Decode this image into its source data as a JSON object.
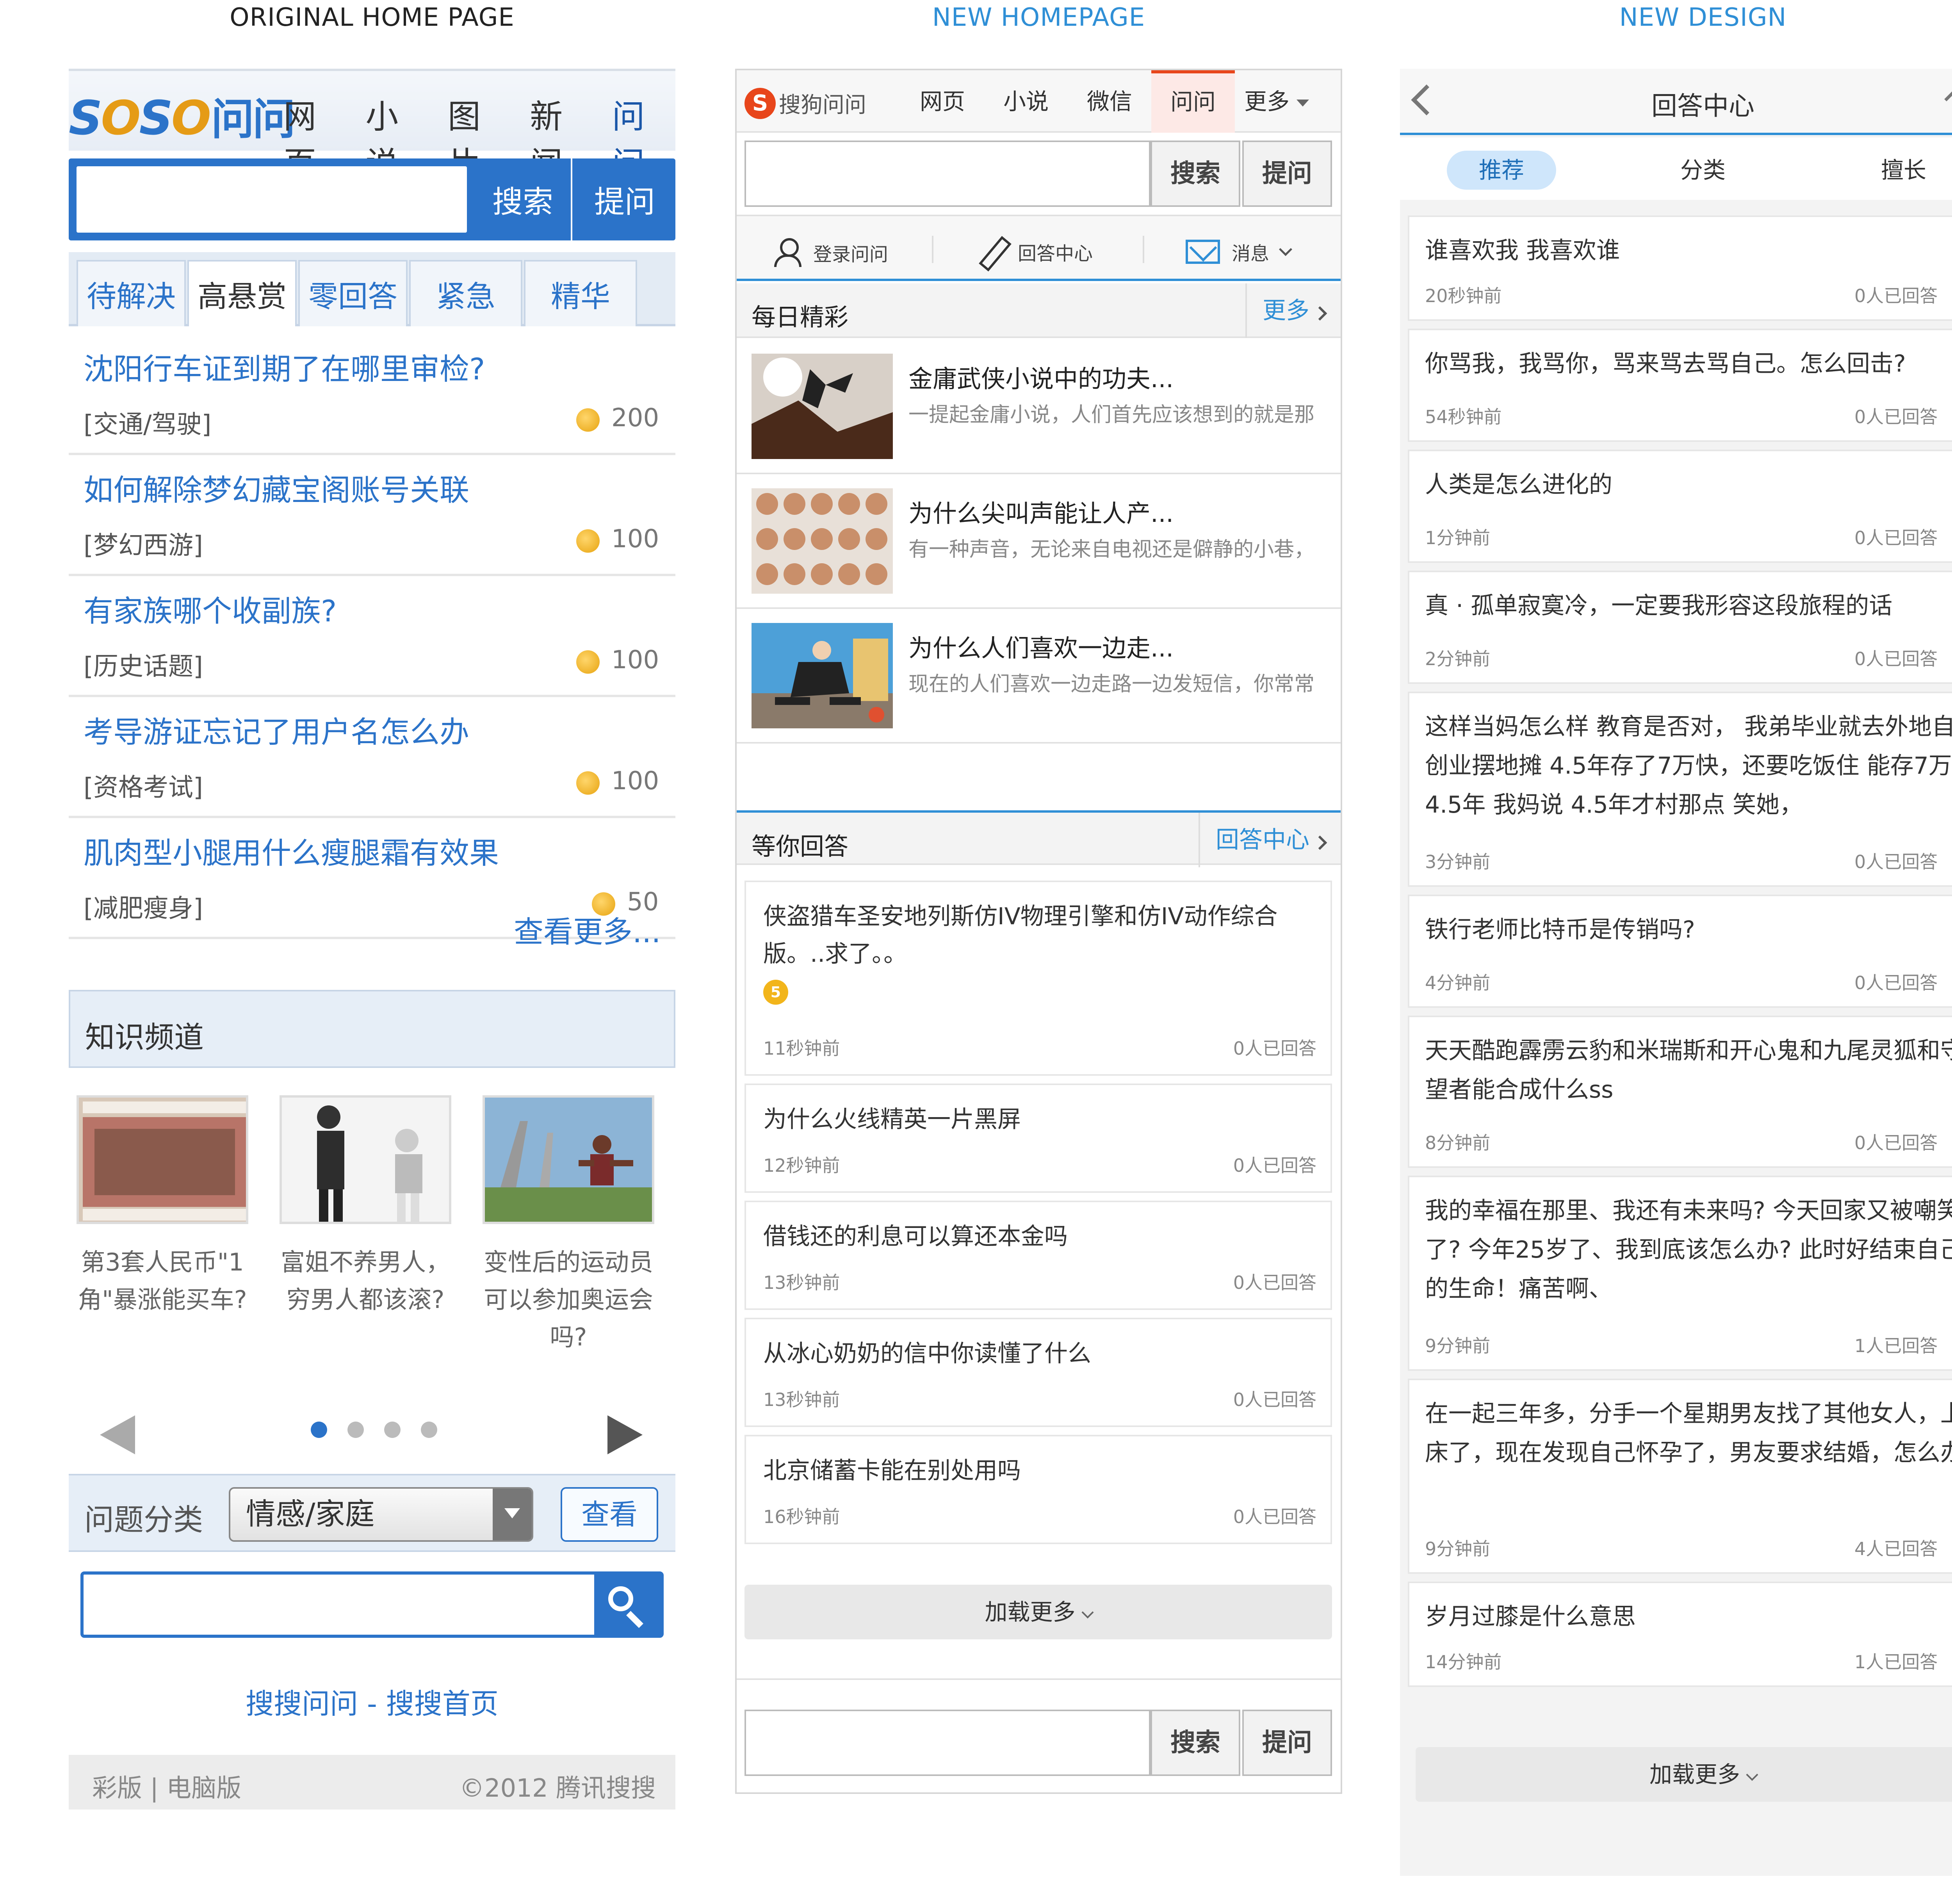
{
  "panels": {
    "original": {
      "title": "ORIGINAL HOME PAGE"
    },
    "new_homepage": {
      "title": "NEW HOMEPAGE"
    },
    "new_design": {
      "title": "NEW DESIGN"
    }
  },
  "original": {
    "logo": "SOSO问问",
    "nav": [
      "网页",
      "小说",
      "图片",
      "新闻",
      "问问"
    ],
    "search_btn": "搜索",
    "ask_btn": "提问",
    "tabs": [
      "待解决",
      "高悬赏",
      "零回答",
      "紧急",
      "精华"
    ],
    "questions": [
      {
        "title": "沈阳行车证到期了在哪里审检?",
        "category": "[交通/驾驶]",
        "reward": "200"
      },
      {
        "title": "如何解除梦幻藏宝阁账号关联",
        "category": "[梦幻西游]",
        "reward": "100"
      },
      {
        "title": "有家族哪个收副族?",
        "category": "[历史话题]",
        "reward": "100"
      },
      {
        "title": "考导游证忘记了用户名怎么办",
        "category": "[资格考试]",
        "reward": "100"
      },
      {
        "title": "肌肉型小腿用什么瘦腿霜有效果",
        "category": "[减肥瘦身]",
        "reward": "50"
      }
    ],
    "more": "查看更多...",
    "knowledge_title": "知识频道",
    "thumbs": [
      {
        "caption": "第3套人民币\"1角\"暴涨能买车?"
      },
      {
        "caption": "富姐不养男人，穷男人都该滚?"
      },
      {
        "caption": "变性后的运动员可以参加奥运会吗?"
      }
    ],
    "category_label": "问题分类",
    "category_value": "情感/家庭",
    "view_btn": "查看",
    "links": "搜搜问问 - 搜搜首页",
    "footer_left": "彩版 | 电脑版",
    "footer_right": "©2012 腾讯搜搜"
  },
  "new_homepage": {
    "logo_mark": "S",
    "logo": "搜狗问问",
    "nav": [
      "网页",
      "小说",
      "微信",
      "问问",
      "更多"
    ],
    "search_btn": "搜索",
    "ask_btn": "提问",
    "actions": [
      "登录问问",
      "回答中心",
      "消息"
    ],
    "daily_title": "每日精彩",
    "daily_more": "更多",
    "articles": [
      {
        "title": "金庸武侠小说中的功夫...",
        "desc": "一提起金庸小说，人们首先应该想到的就是那"
      },
      {
        "title": "为什么尖叫声能让人产...",
        "desc": "有一种声音，无论来自电视还是僻静的小巷，"
      },
      {
        "title": "为什么人们喜欢一边走...",
        "desc": "现在的人们喜欢一边走路一边发短信，你常常"
      }
    ],
    "waiting_title": "等你回答",
    "waiting_more": "回答中心",
    "reward": "5",
    "questions": [
      {
        "title": "侠盗猎车圣安地列斯仿IV物理引擎和仿IV动作综合版。..求了。。",
        "time": "11秒钟前",
        "answers": "0人已回答"
      },
      {
        "title": "为什么火线精英一片黑屏",
        "time": "12秒钟前",
        "answers": "0人已回答"
      },
      {
        "title": "借钱还的利息可以算还本金吗",
        "time": "13秒钟前",
        "answers": "0人已回答"
      },
      {
        "title": "从冰心奶奶的信中你读懂了什么",
        "time": "13秒钟前",
        "answers": "0人已回答"
      },
      {
        "title": "北京储蓄卡能在别处用吗",
        "time": "16秒钟前",
        "answers": "0人已回答"
      }
    ],
    "load_more": "加载更多"
  },
  "new_design": {
    "title": "回答中心",
    "tabs": [
      "推荐",
      "分类",
      "擅长"
    ],
    "questions": [
      {
        "title": "谁喜欢我 我喜欢谁",
        "time": "20秒钟前",
        "answers": "0人已回答"
      },
      {
        "title": "你骂我，我骂你，骂来骂去骂自己。怎么回击?",
        "time": "54秒钟前",
        "answers": "0人已回答"
      },
      {
        "title": "人类是怎么进化的",
        "time": "1分钟前",
        "answers": "0人已回答"
      },
      {
        "title": "真 · 孤单寂寞冷，一定要我形容这段旅程的话",
        "time": "2分钟前",
        "answers": "0人已回答"
      },
      {
        "title": "这样当妈怎么样 教育是否对， 我弟毕业就去外地自己创业摆地摊 4.5年存了7万快，还要吃饭住 能存7万 4.5年 我妈说 4.5年才村那点 笑她，",
        "time": "3分钟前",
        "answers": "0人已回答"
      },
      {
        "title": "铁行老师比特币是传销吗?",
        "time": "4分钟前",
        "answers": "0人已回答"
      },
      {
        "title": "天天酷跑霹雳云豹和米瑞斯和开心鬼和九尾灵狐和守望者能合成什么ss",
        "time": "8分钟前",
        "answers": "0人已回答"
      },
      {
        "title": "我的幸福在那里、我还有未来吗? 今天回家又被嘲笑了? 今年25岁了、我到底该怎么办? 此时好结束自己的生命！痛苦啊、",
        "time": "9分钟前",
        "answers": "1人已回答"
      },
      {
        "title": "在一起三年多，分手一个星期男友找了其他女人，上床了，现在发现自己怀孕了，男友要求结婚，怎么办",
        "time": "9分钟前",
        "answers": "4人已回答"
      },
      {
        "title": "岁月过膝是什么意思",
        "time": "14分钟前",
        "answers": "1人已回答"
      }
    ],
    "load_more": "加载更多"
  }
}
